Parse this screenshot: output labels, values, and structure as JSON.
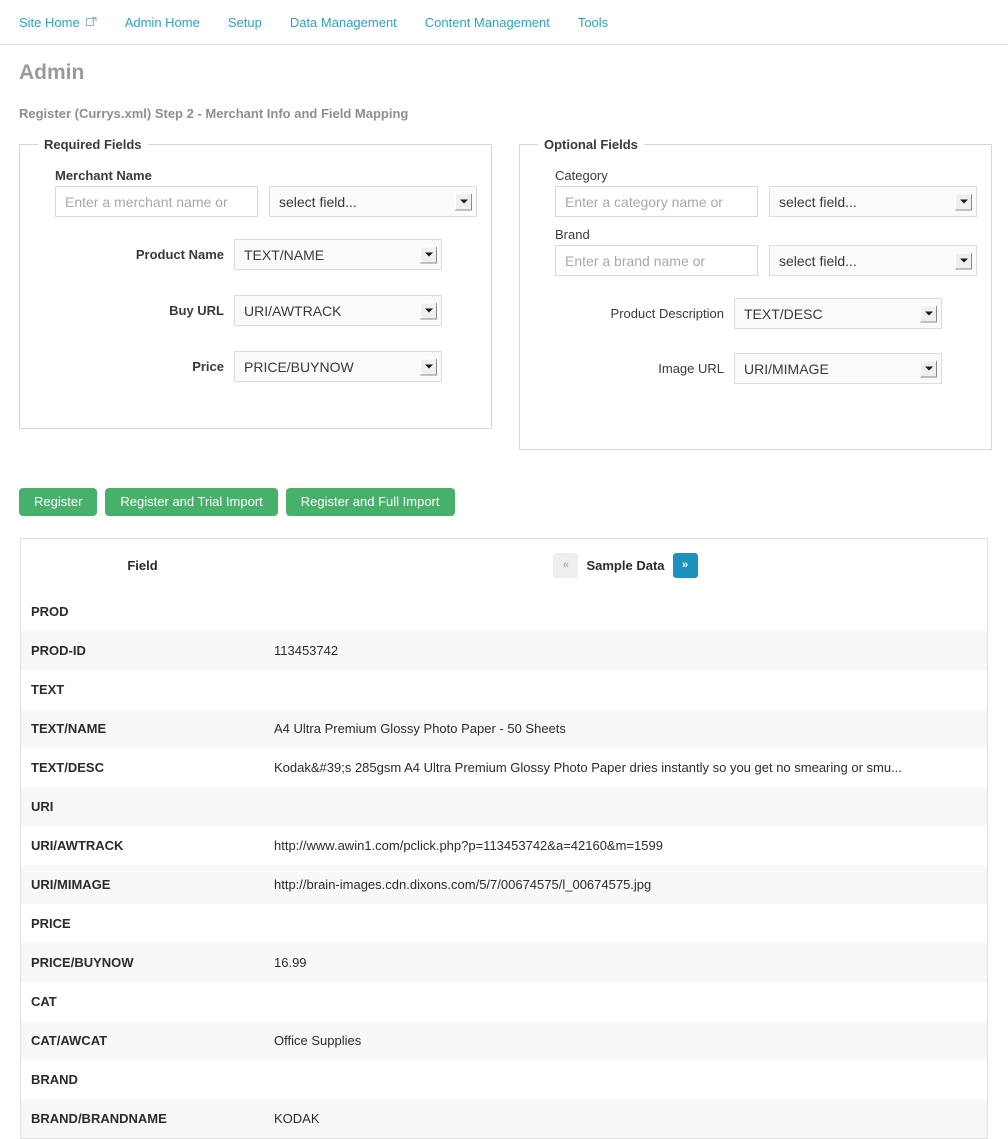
{
  "nav": {
    "items": [
      {
        "label": "Site Home",
        "icon": "external-link-icon",
        "external": true
      },
      {
        "label": "Admin Home",
        "external": false
      },
      {
        "label": "Setup",
        "external": false
      },
      {
        "label": "Data Management",
        "external": false
      },
      {
        "label": "Content Management",
        "external": false
      },
      {
        "label": "Tools",
        "external": false
      }
    ]
  },
  "header": {
    "title": "Admin",
    "subtitle": "Register (Currys.xml) Step 2 - Merchant Info and Field Mapping"
  },
  "required_fields": {
    "legend": "Required Fields",
    "merchant_name": {
      "label": "Merchant Name",
      "input_placeholder": "Enter a merchant name or",
      "input_value": "",
      "select_value": "select field..."
    },
    "product_name": {
      "label": "Product Name",
      "select_value": "TEXT/NAME"
    },
    "buy_url": {
      "label": "Buy URL",
      "select_value": "URI/AWTRACK"
    },
    "price": {
      "label": "Price",
      "select_value": "PRICE/BUYNOW"
    }
  },
  "optional_fields": {
    "legend": "Optional Fields",
    "category": {
      "label": "Category",
      "input_placeholder": "Enter a category name or",
      "input_value": "",
      "select_value": "select field..."
    },
    "brand": {
      "label": "Brand",
      "input_placeholder": "Enter a brand name or",
      "input_value": "",
      "select_value": "select field..."
    },
    "product_description": {
      "label": "Product Description",
      "select_value": "TEXT/DESC"
    },
    "image_url": {
      "label": "Image URL",
      "select_value": "URI/MIMAGE"
    }
  },
  "actions": {
    "register": "Register",
    "register_trial": "Register and Trial Import",
    "register_full": "Register and Full Import"
  },
  "sample_table": {
    "col_field": "Field",
    "col_sample": "Sample Data",
    "pager_prev": "«",
    "pager_next": "»",
    "prev_color": "#eeeeee",
    "next_color": "#1c92bd",
    "rows": [
      {
        "field": "PROD",
        "value": ""
      },
      {
        "field": "PROD-ID",
        "value": "113453742"
      },
      {
        "field": "TEXT",
        "value": ""
      },
      {
        "field": "TEXT/NAME",
        "value": "A4 Ultra Premium Glossy Photo Paper - 50 Sheets"
      },
      {
        "field": "TEXT/DESC",
        "value": "Kodak&#39;s 285gsm A4 Ultra Premium Glossy Photo Paper dries instantly so you get no smearing or smu..."
      },
      {
        "field": "URI",
        "value": ""
      },
      {
        "field": "URI/AWTRACK",
        "value": "http://www.awin1.com/pclick.php?p=113453742&a=42160&m=1599"
      },
      {
        "field": "URI/MIMAGE",
        "value": "http://brain-images.cdn.dixons.com/5/7/00674575/l_00674575.jpg"
      },
      {
        "field": "PRICE",
        "value": ""
      },
      {
        "field": "PRICE/BUYNOW",
        "value": "16.99"
      },
      {
        "field": "CAT",
        "value": ""
      },
      {
        "field": "CAT/AWCAT",
        "value": "Office Supplies"
      },
      {
        "field": "BRAND",
        "value": ""
      },
      {
        "field": "BRAND/BRANDNAME",
        "value": "KODAK"
      }
    ]
  },
  "colors": {
    "nav_link": "#2aa3c4",
    "button_green": "#47b06b",
    "pager_active": "#1c92bd",
    "heading_gray": "#9a9a9a"
  }
}
